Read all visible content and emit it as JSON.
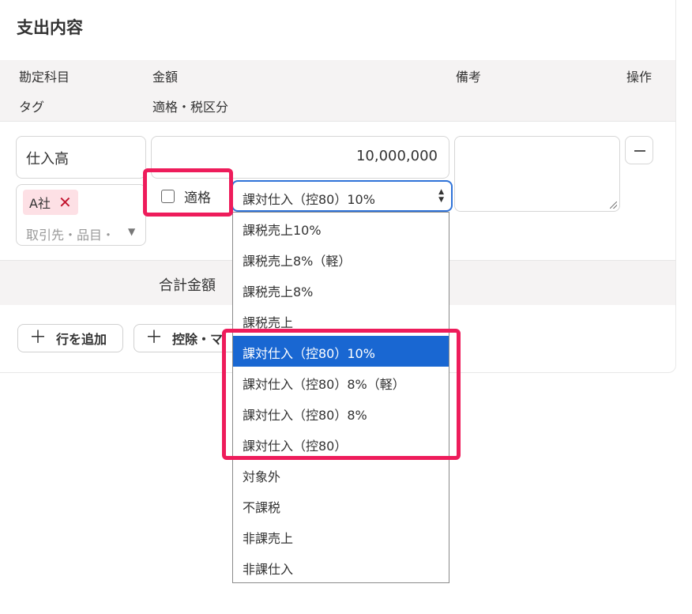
{
  "section": {
    "title": "支出内容"
  },
  "table_header": {
    "row1": {
      "account": "勘定科目",
      "amount": "金額",
      "memo": "備考",
      "action": "操作"
    },
    "row2": {
      "tag": "タグ",
      "tax": "適格・税区分"
    }
  },
  "row": {
    "account": "仕入高",
    "amount": "10,000,000",
    "tag_chip": "A社",
    "tag_placeholder": "取引先・品目・",
    "qualified_label": "適格",
    "qualified_checked": false,
    "tax_selected": "課対仕入（控80）10%"
  },
  "total": {
    "label": "合計金額"
  },
  "buttons": {
    "add_row": "行を追加",
    "deduction": "控除・マ"
  },
  "tax_options": [
    "課税売上10%",
    "課税売上8%（軽）",
    "課税売上8%",
    "課税売上",
    "課対仕入（控80）10%",
    "課対仕入（控80）8%（軽）",
    "課対仕入（控80）8%",
    "課対仕入（控80）",
    "対象外",
    "不課税",
    "非課売上",
    "非課仕入"
  ],
  "selected_option_index": 4,
  "colors": {
    "accent": "#1967d2",
    "highlight": "#ee1c5b",
    "tag_bg": "#fde0e5"
  },
  "icons": {
    "remove_row": "minus-icon",
    "tag_remove": "close-icon",
    "add": "plus-icon",
    "tag_dropdown": "chevron-down-icon",
    "select": "select-arrows-icon"
  }
}
